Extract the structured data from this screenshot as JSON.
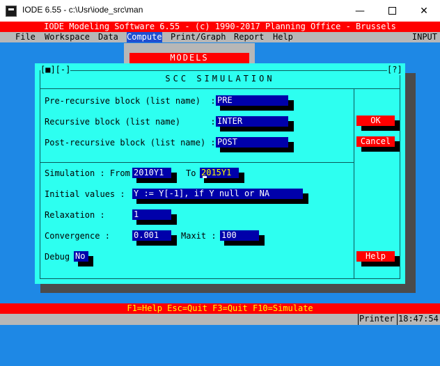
{
  "window": {
    "title": "IODE 6.55 - c:\\Usr\\iode_src\\man",
    "minimize_glyph": "—",
    "close_glyph": "✕"
  },
  "banner": "IODE Modeling Software 6.55 - (c) 1990-2017 Planning Office - Brussels",
  "menubar": {
    "items": [
      "File",
      "Workspace",
      "Data",
      "Compute",
      "Print/Graph",
      "Report",
      "Help"
    ],
    "active": "Compute",
    "right_label": "INPUT"
  },
  "models_popup": {
    "title": "MODELS"
  },
  "dialog": {
    "control": "[■][-]",
    "help": "[?]",
    "title": "SCC SIMULATION",
    "pre_label": "Pre-recursive block (list name)  :",
    "pre_value": "PRE",
    "rec_label": "Recursive block (list name)      :",
    "rec_value": "INTER",
    "post_label": "Post-recursive block (list name) :",
    "post_value": "POST",
    "sim_from_label": "Simulation : From",
    "from_value": "2010Y1",
    "to_label": "To",
    "to_value": "2015Y1",
    "initial_label": "Initial values :",
    "initial_value": "Y := Y[-1], if Y null or NA",
    "relax_label": "Relaxation :",
    "relax_value": "1",
    "conv_label": "Convergence :",
    "conv_value": "0.001",
    "maxit_label": "Maxit :",
    "maxit_value": "100",
    "debug_label": "Debug",
    "debug_value": "No",
    "ok_label": "OK",
    "cancel_label": "Cancel",
    "help_label": "Help"
  },
  "fkeys": "F1=Help Esc=Quit F3=Quit F10=Simulate",
  "status": {
    "printer": "Printer",
    "time": "18:47:54"
  },
  "colors": {
    "dialog_bg": "#2dfff0",
    "field_bg": "#0000aa",
    "banner_bg": "#ff0000",
    "desktop_bg": "#1e88e5",
    "menu_bg": "#b7b7b7"
  }
}
